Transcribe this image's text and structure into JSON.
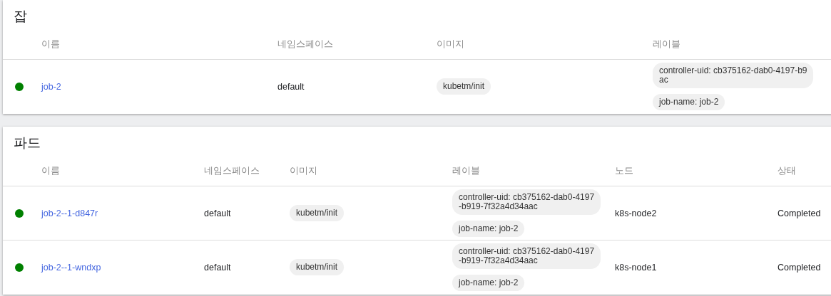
{
  "sections": [
    {
      "kind": "jobs",
      "title": "잡",
      "columns": [
        {
          "kind": "name",
          "label": "이름"
        },
        {
          "kind": "namespace",
          "label": "네임스페이스"
        },
        {
          "kind": "image",
          "label": "이미지"
        },
        {
          "kind": "labels",
          "label": "레이블"
        }
      ],
      "rows": [
        {
          "color": "#008000",
          "name": "job-2",
          "namespace": "default",
          "image": "kubetm/init",
          "labels": [
            [
              "controller-uid: cb375162-dab0-4197-b9",
              "ac"
            ],
            [
              "job-name: job-2"
            ]
          ]
        }
      ]
    },
    {
      "kind": "pods",
      "title": "파드",
      "columns": [
        {
          "kind": "name",
          "label": "이름"
        },
        {
          "kind": "namespace",
          "label": "네임스페이스"
        },
        {
          "kind": "image",
          "label": "이미지"
        },
        {
          "kind": "labels",
          "label": "레이블"
        },
        {
          "kind": "node",
          "label": "노드"
        },
        {
          "kind": "status",
          "label": "상태"
        }
      ],
      "rows": [
        {
          "color": "#008000",
          "name": "job-2--1-d847r",
          "namespace": "default",
          "image": "kubetm/init",
          "labels": [
            [
              "controller-uid: cb375162-dab0-4197",
              "-b919-7f32a4d34aac"
            ],
            [
              "job-name: job-2"
            ]
          ],
          "node": "k8s-node2",
          "status": "Completed"
        },
        {
          "color": "#008000",
          "name": "job-2--1-wndxp",
          "namespace": "default",
          "image": "kubetm/init",
          "labels": [
            [
              "controller-uid: cb375162-dab0-4197",
              "-b919-7f32a4d34aac"
            ],
            [
              "job-name: job-2"
            ]
          ],
          "node": "k8s-node1",
          "status": "Completed"
        }
      ]
    }
  ]
}
